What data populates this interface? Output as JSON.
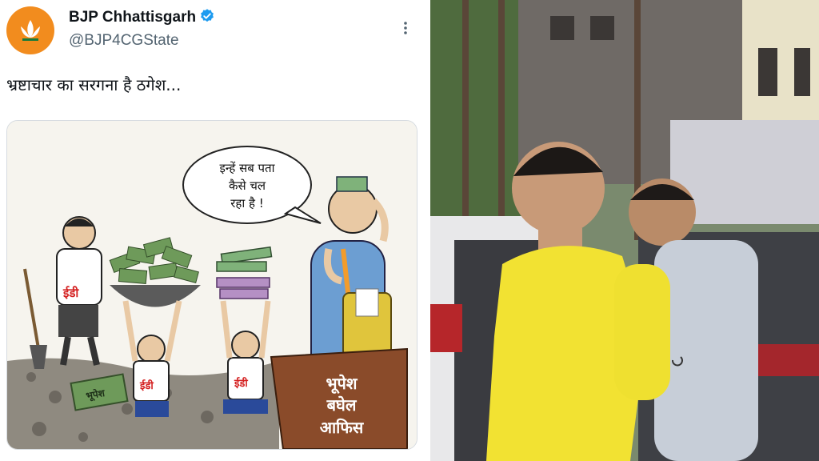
{
  "tweet": {
    "account_name": "BJP Chhattisgarh",
    "handle": "@BJP4CGState",
    "text": "भ्रष्टाचार का सरगना है ठगेश...",
    "icons": {
      "avatar": "bjp-lotus-logo",
      "verified": "verified-badge-icon",
      "more": "more-options-icon"
    },
    "cartoon": {
      "speech_bubble": [
        "इन्हें सब पता",
        "कैसे चल",
        "रहा है !"
      ],
      "ed_label": "ईडी",
      "bag_label": "भूपेश",
      "desk_label": [
        "भूपेश",
        "बघेल",
        "आफिस"
      ]
    }
  },
  "colors": {
    "verified": "#1d9bf0",
    "avatar_bg": "#f28c1e",
    "shirt": "#f2e232"
  }
}
